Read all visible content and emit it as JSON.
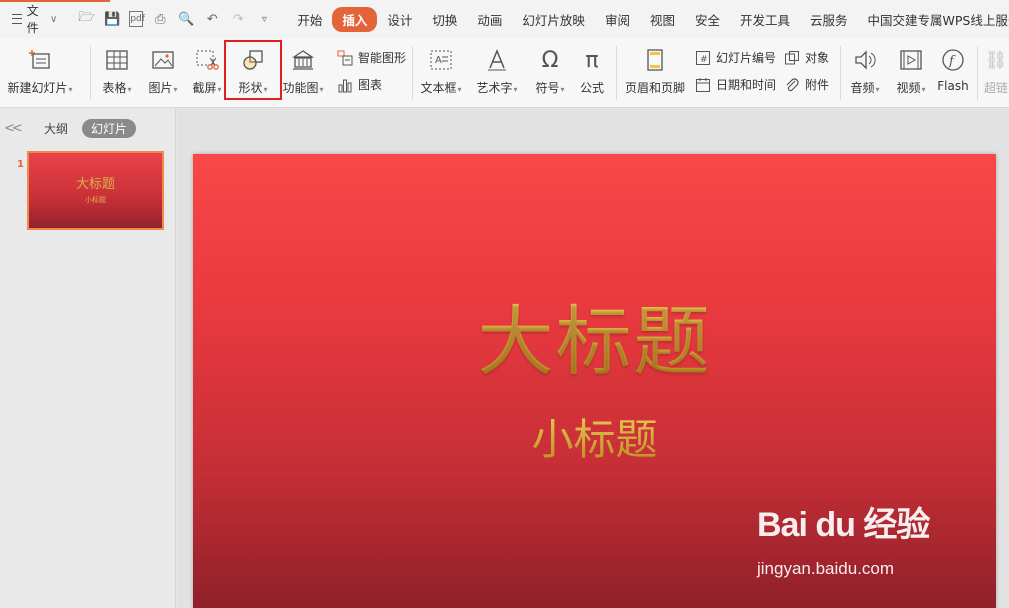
{
  "menubar": {
    "file_label": "文件",
    "tabs": [
      "开始",
      "插入",
      "设计",
      "切换",
      "动画",
      "幻灯片放映",
      "审阅",
      "视图",
      "安全",
      "开发工具",
      "云服务",
      "中国交建专属WPS线上服务通道"
    ],
    "active_tab": "插入"
  },
  "ribbon": {
    "new_slide": "新建幻灯片",
    "table": "表格",
    "picture": "图片",
    "screenshot": "截屏",
    "shape": "形状",
    "function_chart": "功能图",
    "smart_art": "智能图形",
    "chart": "图表",
    "textbox": "文本框",
    "wordart": "艺术字",
    "symbol": "符号",
    "formula": "公式",
    "header_footer": "页眉和页脚",
    "slide_number": "幻灯片编号",
    "object": "对象",
    "date_time": "日期和时间",
    "attachment": "附件",
    "audio": "音频",
    "video": "视频",
    "flash": "Flash",
    "hyperlink": "超链"
  },
  "left_panel": {
    "outline_tab": "大纲",
    "slides_tab": "幻灯片",
    "slide_number": "1",
    "thumb_title": "大标题",
    "thumb_subtitle": "小标题"
  },
  "slide": {
    "title": "大标题",
    "subtitle": "小标题"
  },
  "watermark": {
    "logo": "Bai du 经验",
    "url": "jingyan.baidu.com"
  },
  "colors": {
    "accent": "#e4643a",
    "slide_top": "#fa4748",
    "slide_bottom": "#8f2029",
    "title_gold": "#d8b24a",
    "highlight": "#e02020"
  }
}
